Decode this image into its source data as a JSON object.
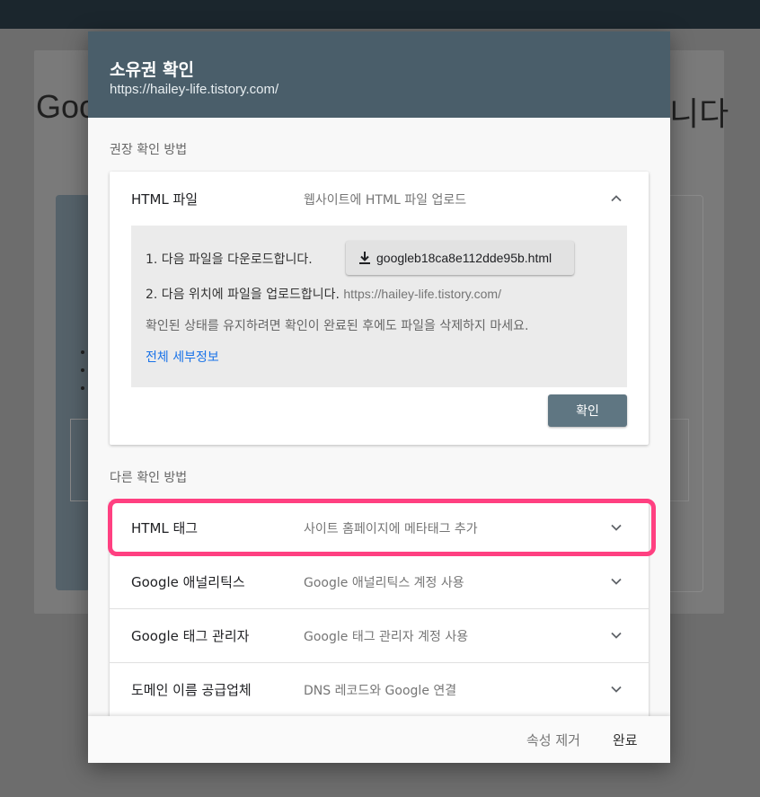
{
  "background": {
    "title_left": "Goo",
    "title_right": "니다"
  },
  "dialog": {
    "title": "소유권 확인",
    "subtitle": "https://hailey-life.tistory.com/",
    "recommended_label": "권장 확인 방법",
    "other_label": "다른 확인 방법",
    "html_file": {
      "title": "HTML 파일",
      "desc": "웹사이트에 HTML 파일 업로드",
      "step1": "1. 다음 파일을 다운로드합니다.",
      "download_file": "googleb18ca8e112dde95b.html",
      "step2": "2. 다음 위치에 파일을 업로드합니다.",
      "step2_url": "https://hailey-life.tistory.com/",
      "keep_note": "확인된 상태를 유지하려면 확인이 완료된 후에도 파일을 삭제하지 마세요.",
      "details_link": "전체 세부정보",
      "confirm_label": "확인"
    },
    "methods": [
      {
        "title": "HTML 태그",
        "desc": "사이트 홈페이지에 메타태그 추가"
      },
      {
        "title": "Google 애널리틱스",
        "desc": "Google 애널리틱스 계정 사용"
      },
      {
        "title": "Google 태그 관리자",
        "desc": "Google 태그 관리자 계정 사용"
      },
      {
        "title": "도메인 이름 공급업체",
        "desc": "DNS 레코드와 Google 연결"
      }
    ],
    "footer": {
      "remove_label": "속성 제거",
      "done_label": "완료"
    }
  },
  "colors": {
    "header": "#4a5e6a",
    "confirm_button": "#5f7682",
    "link": "#1a73e8",
    "highlight": "#ff4081"
  },
  "icons": {
    "expand": "chevron-up-icon",
    "collapse": "chevron-down-icon",
    "download": "download-icon"
  }
}
